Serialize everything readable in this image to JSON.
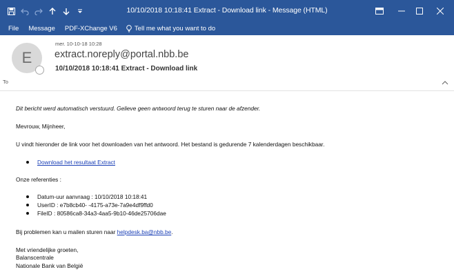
{
  "titlebar": {
    "title": "10/10/2018 10:18:41 Extract - Download link  -  Message (HTML)",
    "qat_icons": [
      "save-icon",
      "undo-icon",
      "redo-icon",
      "up-arrow-icon",
      "down-arrow-icon",
      "customize-icon"
    ],
    "controls": [
      "ribbon-display-icon",
      "minimize-icon",
      "maximize-icon",
      "close-icon"
    ],
    "background": "#2b579a"
  },
  "ribbon": {
    "tabs": [
      "File",
      "Message",
      "PDF-XChange V6"
    ],
    "tell_me": "Tell me what you want to do"
  },
  "message": {
    "avatar_initial": "E",
    "date": "mer. 10-10-18 10:28",
    "sender": "extract.noreply@portal.nbb.be",
    "subject": "10/10/2018 10:18:41 Extract - Download link",
    "to_label": "To"
  },
  "body": {
    "auto_notice": "Dit bericht werd automatisch verstuurd. Gelieve geen antwoord terug te sturen naar de afzender.",
    "greeting": "Mevrouw, Mijnheer,",
    "intro": "U vindt hieronder de link voor het downloaden van het antwoord. Het bestand is gedurende 7 kalenderdagen beschikbaar.",
    "download_link": "Download het resultaat Extract",
    "references_heading": "Onze referenties :",
    "references": [
      "Datum-uur aanvraag : 10/10/2018 10:18:41",
      "UserID : e7b8cb40-        -4175-a73e-7a9e4df9ffd0",
      "FileID : 80586ca8-34a3-4aa5-9b10-46de25706dae"
    ],
    "problems_prefix": "Bij problemen kan u mailen sturen naar ",
    "helpdesk_email": "helpdesk.ba@nbb.be",
    "problems_suffix": ".",
    "closing": "Met vriendelijke groeten,",
    "signature_1": "Balanscentrale",
    "signature_2": "Nationale Bank van België",
    "link_color": "#1a3fb6"
  }
}
